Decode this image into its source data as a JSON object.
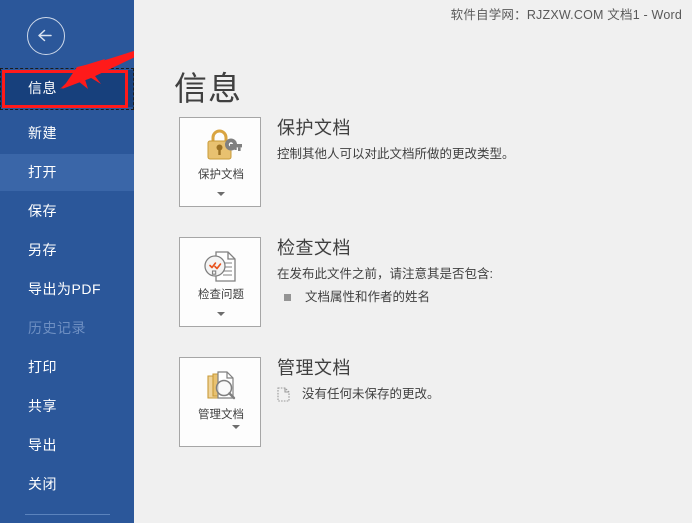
{
  "window": {
    "title": "软件自学网：RJZXW.COM 文档1  -  Word"
  },
  "sidebar": {
    "back_icon": "back-arrow-icon",
    "items": [
      {
        "label": "信息",
        "state": "selected"
      },
      {
        "label": "新建",
        "state": "normal"
      },
      {
        "label": "打开",
        "state": "hovered"
      },
      {
        "label": "保存",
        "state": "normal"
      },
      {
        "label": "另存",
        "state": "normal"
      },
      {
        "label": "导出为PDF",
        "state": "normal"
      },
      {
        "label": "历史记录",
        "state": "disabled"
      },
      {
        "label": "打印",
        "state": "normal"
      },
      {
        "label": "共享",
        "state": "normal"
      },
      {
        "label": "导出",
        "state": "normal"
      },
      {
        "label": "关闭",
        "state": "normal"
      }
    ]
  },
  "annotation": {
    "highlight_color": "#ff1a1a",
    "target_label": "信息"
  },
  "main": {
    "page_title": "信息",
    "sections": [
      {
        "card_label": "保护文档",
        "card_icon": "lock-and-key-icon",
        "heading": "保护文档",
        "description": "控制其他人可以对此文档所做的更改类型。",
        "bullets": []
      },
      {
        "card_label": "检查问题",
        "card_icon": "document-inspect-icon",
        "heading": "检查文档",
        "description": "在发布此文件之前，请注意其是否包含:",
        "bullets": [
          "文档属性和作者的姓名"
        ]
      },
      {
        "card_label": "管理文档",
        "card_icon": "manage-documents-icon",
        "heading": "管理文档",
        "description": "",
        "doc_note": "没有任何未保存的更改。",
        "bullets": []
      }
    ]
  },
  "colors": {
    "sidebar_bg": "#2b579a",
    "sidebar_selected": "#17407c",
    "sidebar_hover": "#3a66a8",
    "main_bg": "#f0f0f0",
    "accent_red": "#ff1a1a",
    "icon_gold": "#e8c170",
    "icon_gray": "#808080",
    "check_orange": "#e8541f"
  }
}
